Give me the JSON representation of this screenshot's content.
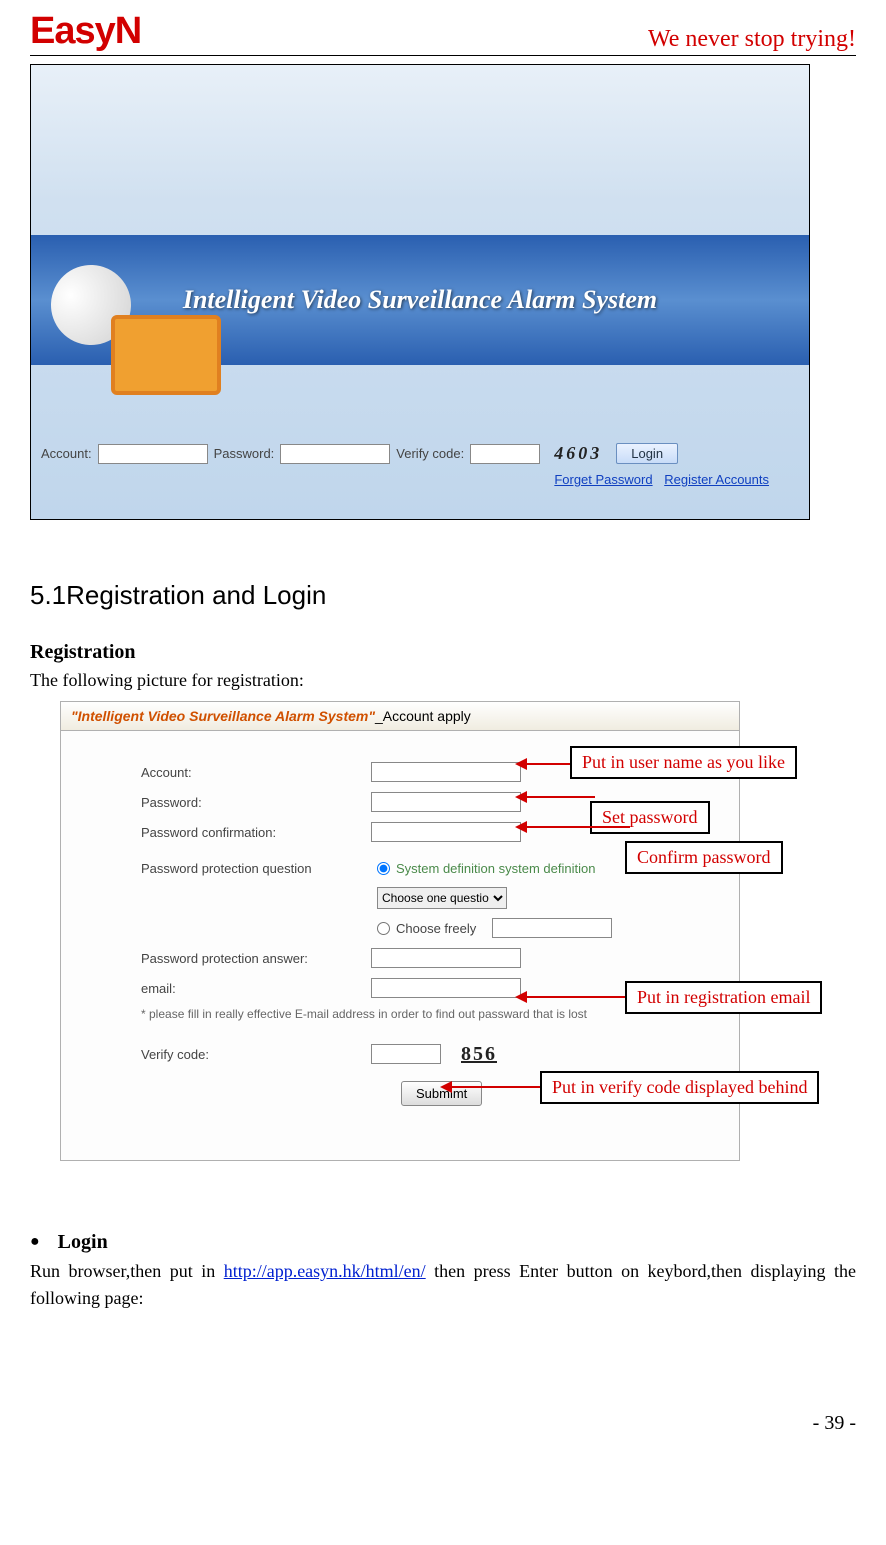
{
  "header": {
    "logo": "EasyN",
    "tagline": "We never stop trying!"
  },
  "login_screenshot": {
    "banner": "Intelligent Video Surveillance Alarm System",
    "labels": {
      "account": "Account:",
      "password": "Password:",
      "verify": "Verify code:"
    },
    "captcha": "4603",
    "login_button": "Login",
    "links": {
      "forget": "Forget Password",
      "register": "Register Accounts"
    }
  },
  "section": {
    "title": "5.1Registration and Login",
    "registration_heading": "Registration",
    "registration_intro": "The following picture for registration:"
  },
  "reg_screenshot": {
    "titlebar_prefix": "\"Intelligent Video Surveillance Alarm System\"",
    "titlebar_suffix": "_Account apply",
    "fields": {
      "account": "Account:",
      "password": "Password:",
      "password_confirm": "Password confirmation:",
      "ppq": "Password protection question",
      "ppq_opt_system": "System definition system definition",
      "ppq_select": "Choose one questio",
      "ppq_opt_free": "Choose freely",
      "ppa": "Password protection answer:",
      "email": "email:",
      "email_hint": "* please fill in really effective E-mail address in order to find out passward that is lost",
      "verify": "Verify code:",
      "captcha": "856",
      "submit": "Submimt"
    }
  },
  "callouts": {
    "c1": "Put in user name as you like",
    "c2": "Set  password",
    "c3": "Confirm  password",
    "c4": "Put in registration email",
    "c5": "Put in verify code displayed behind"
  },
  "login_section": {
    "heading": "Login",
    "text_before": "Run browser,then put in ",
    "url": "http://app.easyn.hk/html/en/",
    "text_after": " then press Enter button on keybord,then displaying the following page:"
  },
  "page_number": "- 39 -"
}
